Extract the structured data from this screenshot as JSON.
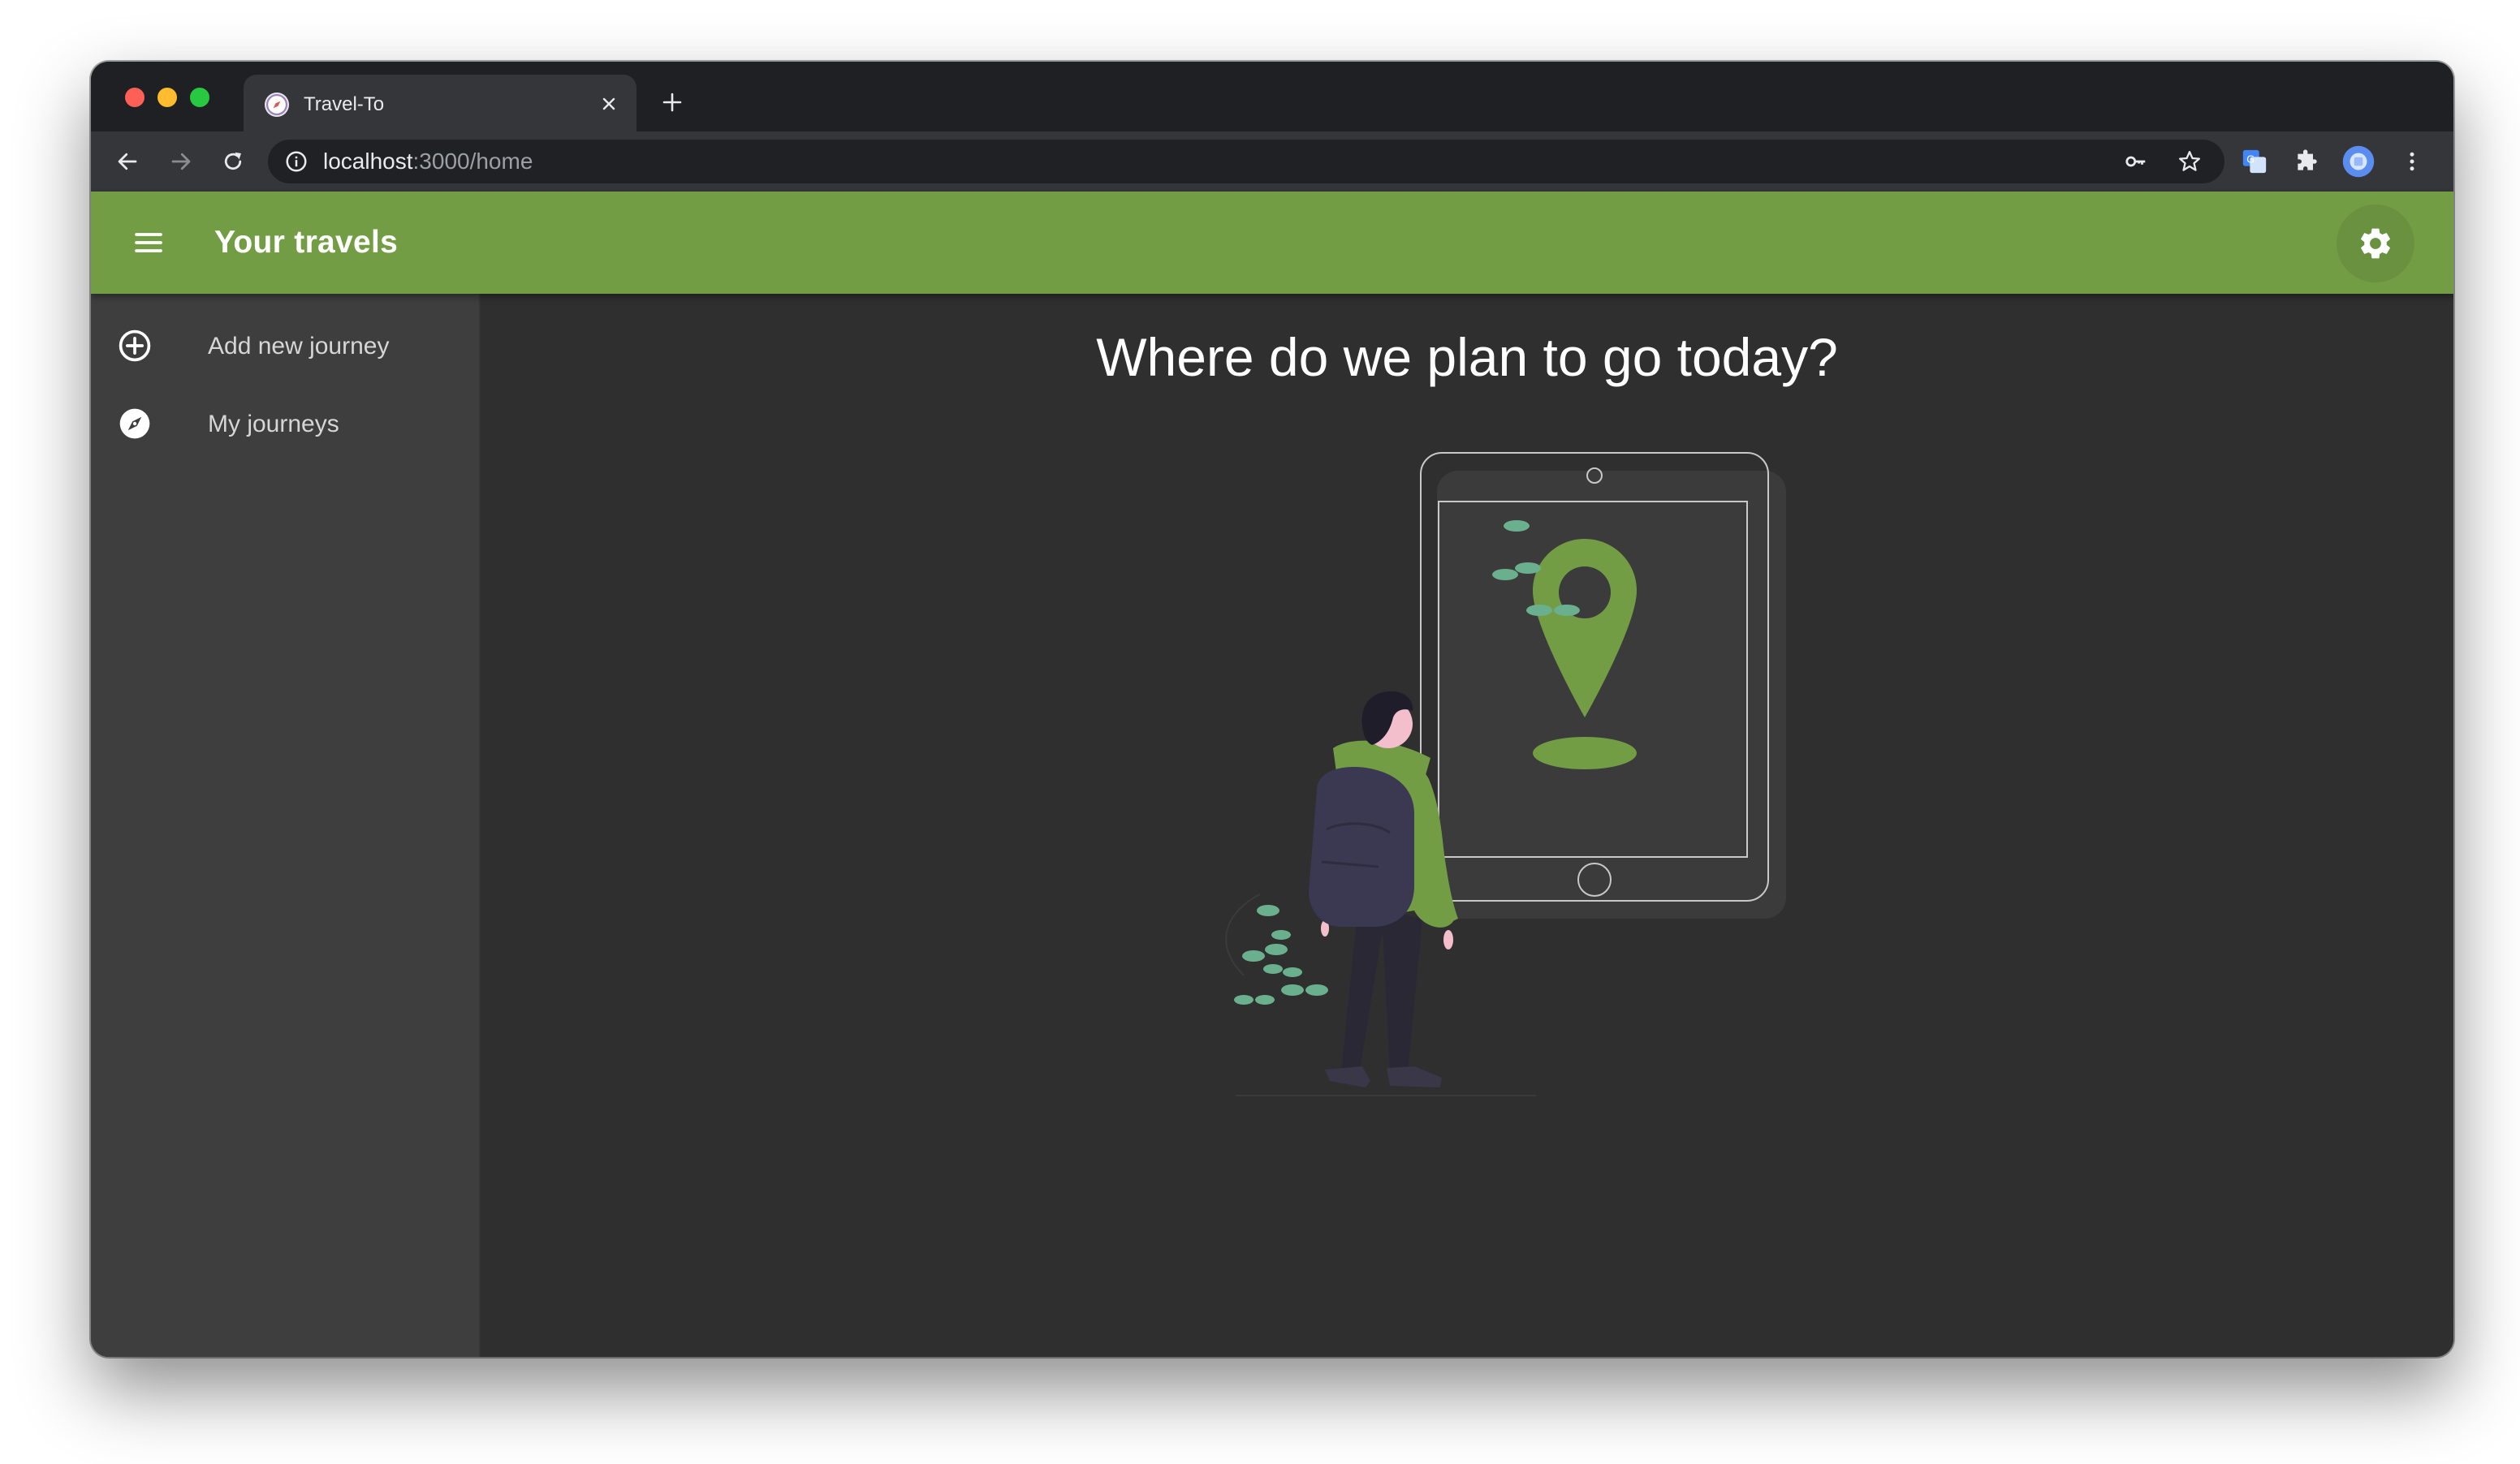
{
  "browser": {
    "tab_title": "Travel-To",
    "url_host": "localhost",
    "url_path": ":3000/home"
  },
  "appbar": {
    "title": "Your travels"
  },
  "sidebar": {
    "items": [
      {
        "label": "Add new journey",
        "icon": "add-circle-icon"
      },
      {
        "label": "My journeys",
        "icon": "compass-icon"
      }
    ]
  },
  "main": {
    "heading": "Where do we plan to go today?"
  },
  "colors": {
    "accent": "#739d45",
    "leaf": "#6bb08e",
    "background": "#2f2f2f",
    "sidebar": "#3e3e3e"
  }
}
